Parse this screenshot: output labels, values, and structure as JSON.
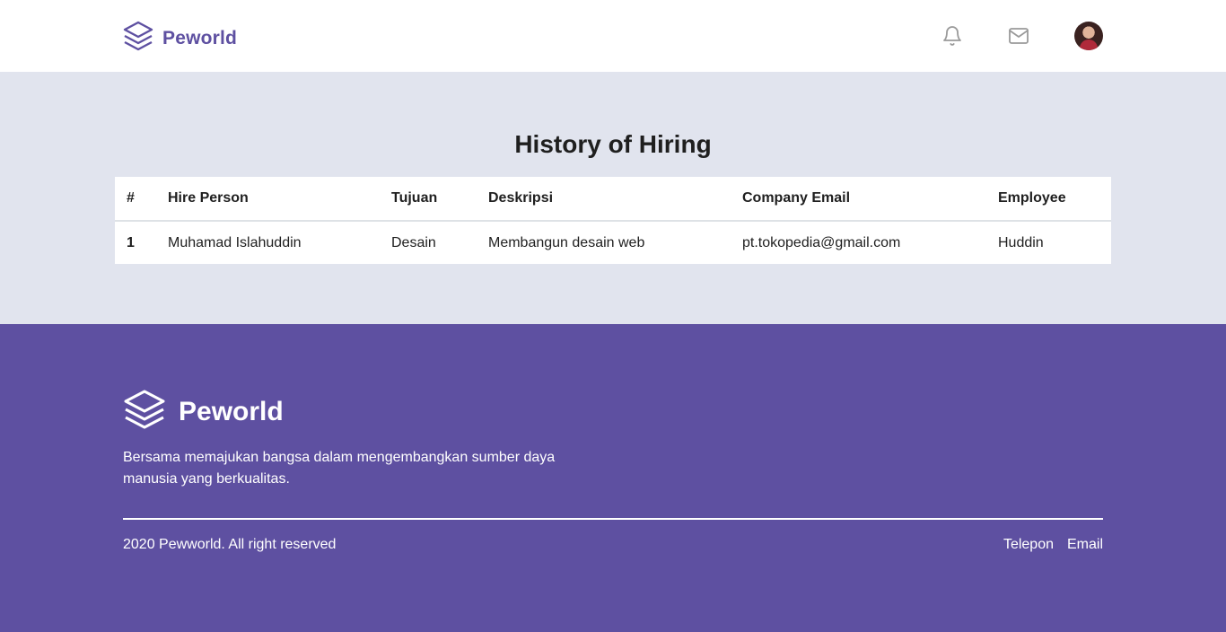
{
  "navbar": {
    "brand": "Peworld",
    "icons": [
      "layers-logo-icon",
      "bell-icon",
      "mail-icon",
      "avatar"
    ],
    "brand_color": "#5e50a1"
  },
  "main": {
    "title": "History of Hiring",
    "table": {
      "headers": [
        "#",
        "Hire Person",
        "Tujuan",
        "Deskripsi",
        "Company Email",
        "Employee"
      ],
      "rows": [
        [
          "1",
          "Muhamad Islahuddin",
          "Desain",
          "Membangun desain web",
          "pt.tokopedia@gmail.com",
          "Huddin"
        ]
      ]
    },
    "background_color": "#e1e4ee"
  },
  "footer": {
    "brand": "Peworld",
    "description": "Bersama memajukan bangsa dalam mengembangkan sumber daya manusia yang berkualitas.",
    "copyright": "2020 Pewworld. All right reserved",
    "links": [
      "Telepon",
      "Email"
    ],
    "background_color": "#5e50a1"
  }
}
